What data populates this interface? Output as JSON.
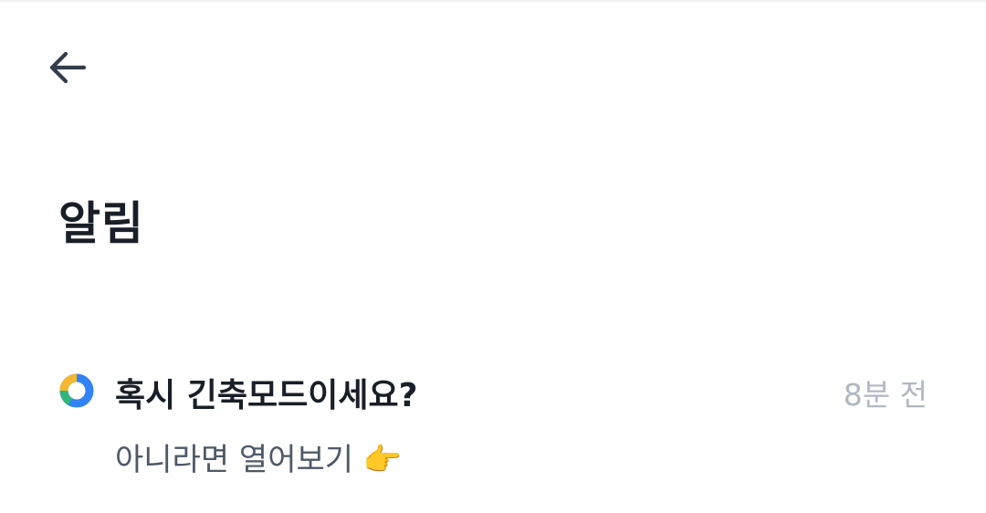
{
  "page": {
    "title": "알림"
  },
  "header": {
    "back_icon": "arrow-left-icon",
    "icon_color": "#333d4b"
  },
  "notifications": [
    {
      "title": "혹시 긴축모드이세요?",
      "time": "8분 전",
      "body": "아니라면 열어보기 👉",
      "icon": "donut-ring-icon",
      "icon_colors": [
        "#3182f6",
        "#f5b82e",
        "#2fb67c"
      ]
    }
  ],
  "colors": {
    "title": "#191f28",
    "body": "#4e5968",
    "muted": "#b0b8c1"
  }
}
